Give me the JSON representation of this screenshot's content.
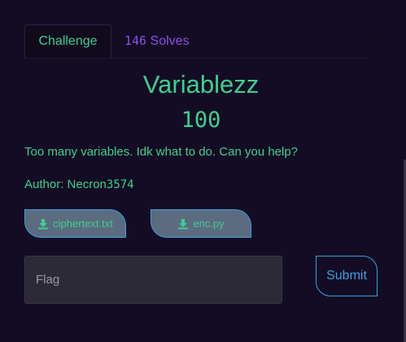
{
  "modal": {
    "close_label": "×"
  },
  "tabs": {
    "challenge_label": "Challenge",
    "solves_count": "146",
    "solves_label": "Solves"
  },
  "challenge": {
    "name": "Variablezz",
    "value": "100",
    "description": "Too many variables. Idk what to do. Can you help?",
    "author_label": "Author: Necron",
    "author_number": "3574"
  },
  "files": [
    {
      "label": "ciphertext.txt",
      "icon": "download-icon"
    },
    {
      "label": "enc.py",
      "icon": "download-icon"
    }
  ],
  "flag_form": {
    "placeholder": "Flag",
    "submit_label": "Submit"
  },
  "colors": {
    "background": "#140c24",
    "accent_green": "#3ecf8e",
    "accent_purple": "#8a50e8",
    "accent_blue": "#3aa0e0",
    "file_button_bg": "#5b6b80"
  }
}
